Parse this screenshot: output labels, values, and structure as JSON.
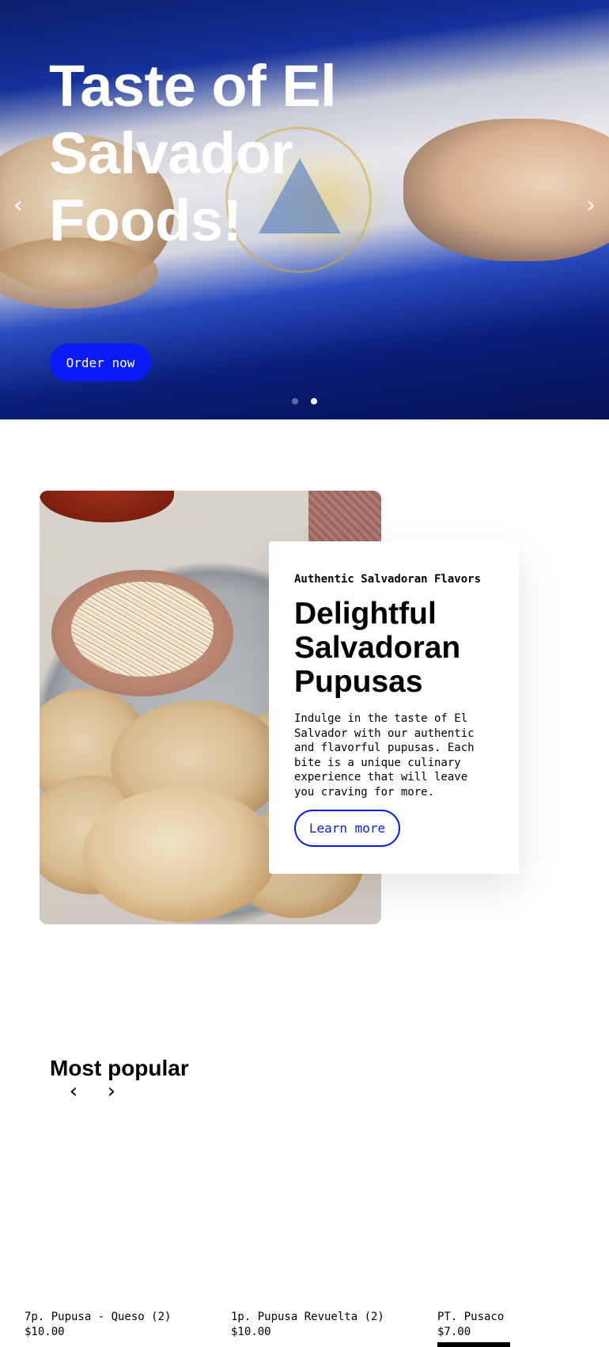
{
  "hero": {
    "title": "Taste of El Salvador Foods!",
    "cta_label": "Order now",
    "prev_arrow": "‹",
    "next_arrow": "›",
    "slide_count": 2,
    "active_slide": 2
  },
  "feature": {
    "eyebrow": "Authentic Salvadoran Flavors",
    "title": "Delightful Salvadoran Pupusas",
    "description": "Indulge in the taste of El Salvador with our authentic and flavorful pupusas. Each bite is a unique culinary experience that will leave you craving for more.",
    "cta_label": "Learn more"
  },
  "popular": {
    "title": "Most popular",
    "prev_arrow": "‹",
    "next_arrow": "›",
    "products": [
      {
        "name": "7p. Pupusa - Queso (2)",
        "price": "$10.00"
      },
      {
        "name": "1p. Pupusa Revuelta (2)",
        "price": "$10.00"
      },
      {
        "name": "PT. Pusaco",
        "price": "$7.00"
      }
    ]
  },
  "colors": {
    "accent": "#0a1cf5",
    "text": "#000000",
    "background": "#ffffff"
  }
}
